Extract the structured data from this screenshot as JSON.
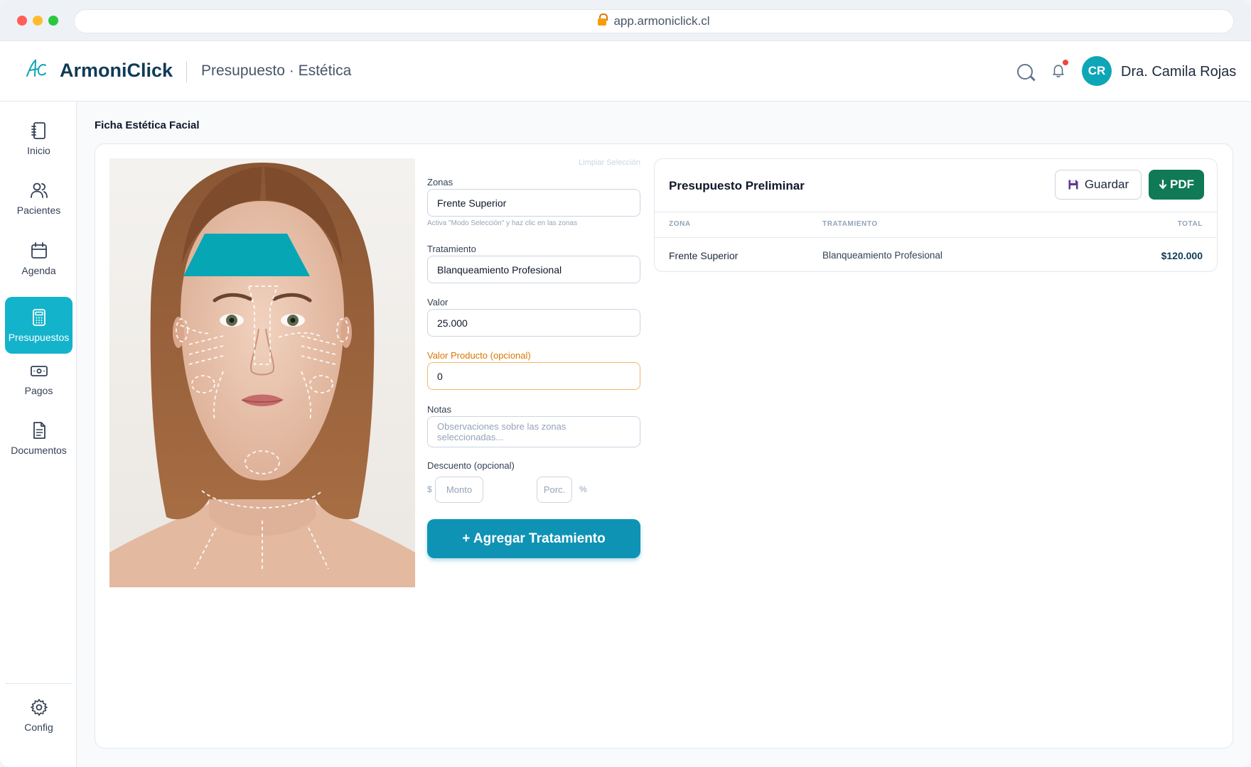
{
  "browser": {
    "url": "app.armoniclick.cl"
  },
  "header": {
    "logo_mark": "AC",
    "brand": "ArmoniClick",
    "page_subtitle": "Presupuesto · Estética",
    "user": {
      "initials": "CR",
      "name": "Dra. Camila Rojas"
    }
  },
  "sidebar": {
    "items": [
      {
        "label": "Inicio",
        "icon": "notebook-icon",
        "active": false
      },
      {
        "label": "Pacientes",
        "icon": "users-icon",
        "active": false
      },
      {
        "label": "Agenda",
        "icon": "calendar-icon",
        "active": false
      },
      {
        "label": "Presupuestos",
        "icon": "calculator-icon",
        "active": true
      },
      {
        "label": "Pagos",
        "icon": "banknote-icon",
        "active": false
      },
      {
        "label": "Documentos",
        "icon": "document-icon",
        "active": false
      }
    ],
    "footer": {
      "label": "Config",
      "icon": "gear-icon"
    }
  },
  "main": {
    "section_title": "Ficha Estética Facial",
    "form": {
      "clear_link": "Limpiar Selección",
      "zonas": {
        "label": "Zonas",
        "value": "Frente Superior",
        "hint": "Activa \"Modo Selección\" y haz clic en las zonas"
      },
      "tratamiento": {
        "label": "Tratamiento",
        "value": "Blanqueamiento Profesional"
      },
      "valor": {
        "label": "Valor",
        "value": "25.000"
      },
      "valor_producto": {
        "label": "Valor Producto (opcional)",
        "value": "0"
      },
      "notas": {
        "label": "Notas",
        "placeholder": "Observaciones sobre las zonas seleccionadas..."
      },
      "descuento": {
        "label": "Descuento (opcional)",
        "currency": "$",
        "monto_placeholder": "Monto",
        "porc_placeholder": "Porc.",
        "percent": "%"
      },
      "add_button": "+ Agregar Tratamiento"
    },
    "budget": {
      "title": "Presupuesto Preliminar",
      "save_label": "Guardar",
      "pdf_label": "PDF",
      "columns": [
        "ZONA",
        "TRATAMIENTO",
        "TOTAL"
      ],
      "rows": [
        {
          "zona": "Frente Superior",
          "tratamiento": "Blanqueamiento Profesional",
          "total": "$120.000"
        }
      ]
    }
  },
  "colors": {
    "accent": "#14b3cc",
    "brand": "#0f3b57",
    "primary_button": "#0f93b5",
    "pdf_button": "#0f7a55",
    "selected_zone": "#06a6b5"
  }
}
